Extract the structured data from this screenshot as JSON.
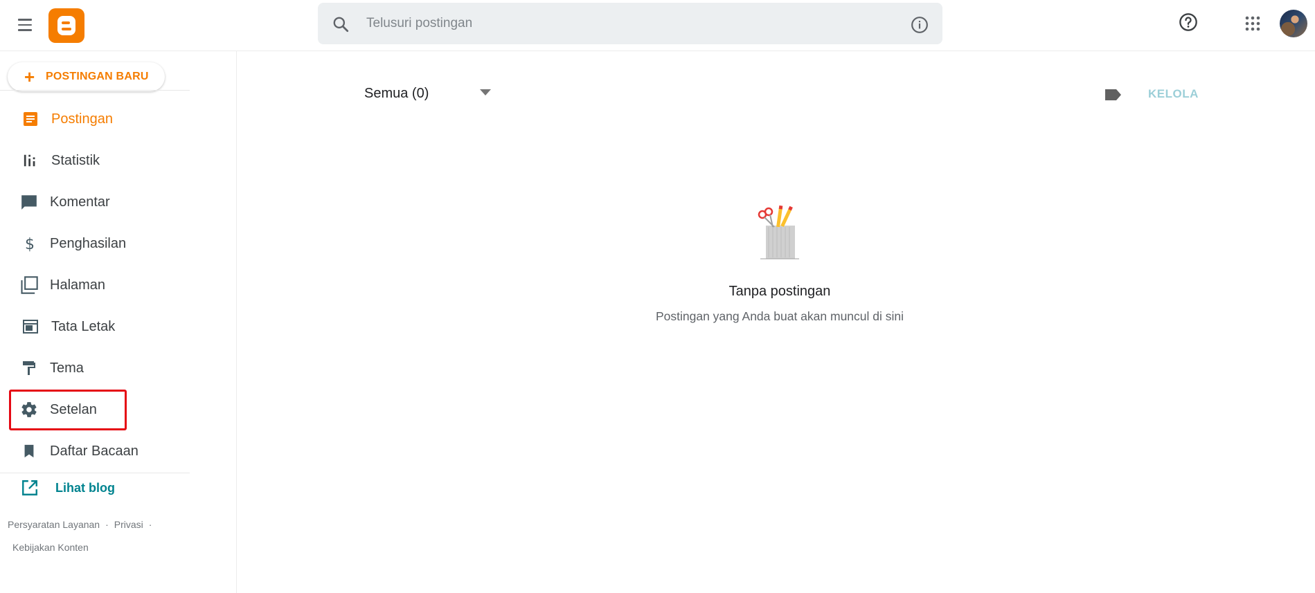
{
  "colors": {
    "brand": "#f57d00",
    "accent_link": "#00838f",
    "highlight": "#e50914",
    "manage_disabled": "#9ccfd8"
  },
  "header": {
    "search": {
      "placeholder": "Telusuri postingan"
    },
    "icons": [
      "menu-icon",
      "blogger-logo",
      "search-icon",
      "info-icon",
      "help-icon",
      "apps-icon",
      "avatar"
    ]
  },
  "sidebar": {
    "new_post_label": "POSTINGAN BARU",
    "items": [
      {
        "label": "Postingan",
        "icon": "posts-icon",
        "active": true
      },
      {
        "label": "Statistik",
        "icon": "stats-icon",
        "active": false
      },
      {
        "label": "Komentar",
        "icon": "comment-icon",
        "active": false
      },
      {
        "label": "Penghasilan",
        "icon": "dollar-icon",
        "active": false
      },
      {
        "label": "Halaman",
        "icon": "pages-icon",
        "active": false
      },
      {
        "label": "Tata Letak",
        "icon": "layout-icon",
        "active": false
      },
      {
        "label": "Tema",
        "icon": "paint-roller-icon",
        "active": false
      },
      {
        "label": "Setelan",
        "icon": "gear-icon",
        "active": false,
        "highlighted": true
      },
      {
        "label": "Daftar Bacaan",
        "icon": "bookmark-icon",
        "active": false
      }
    ],
    "view_blog_label": "Lihat blog",
    "footer": {
      "terms": "Persyaratan Layanan",
      "privacy": "Privasi",
      "content_policy": "Kebijakan Konten",
      "separator": "·"
    }
  },
  "main": {
    "filter_label": "Semua (0)",
    "manage_label": "KELOLA",
    "empty_title": "Tanpa postingan",
    "empty_subtitle": "Postingan yang Anda buat akan muncul di sini"
  }
}
